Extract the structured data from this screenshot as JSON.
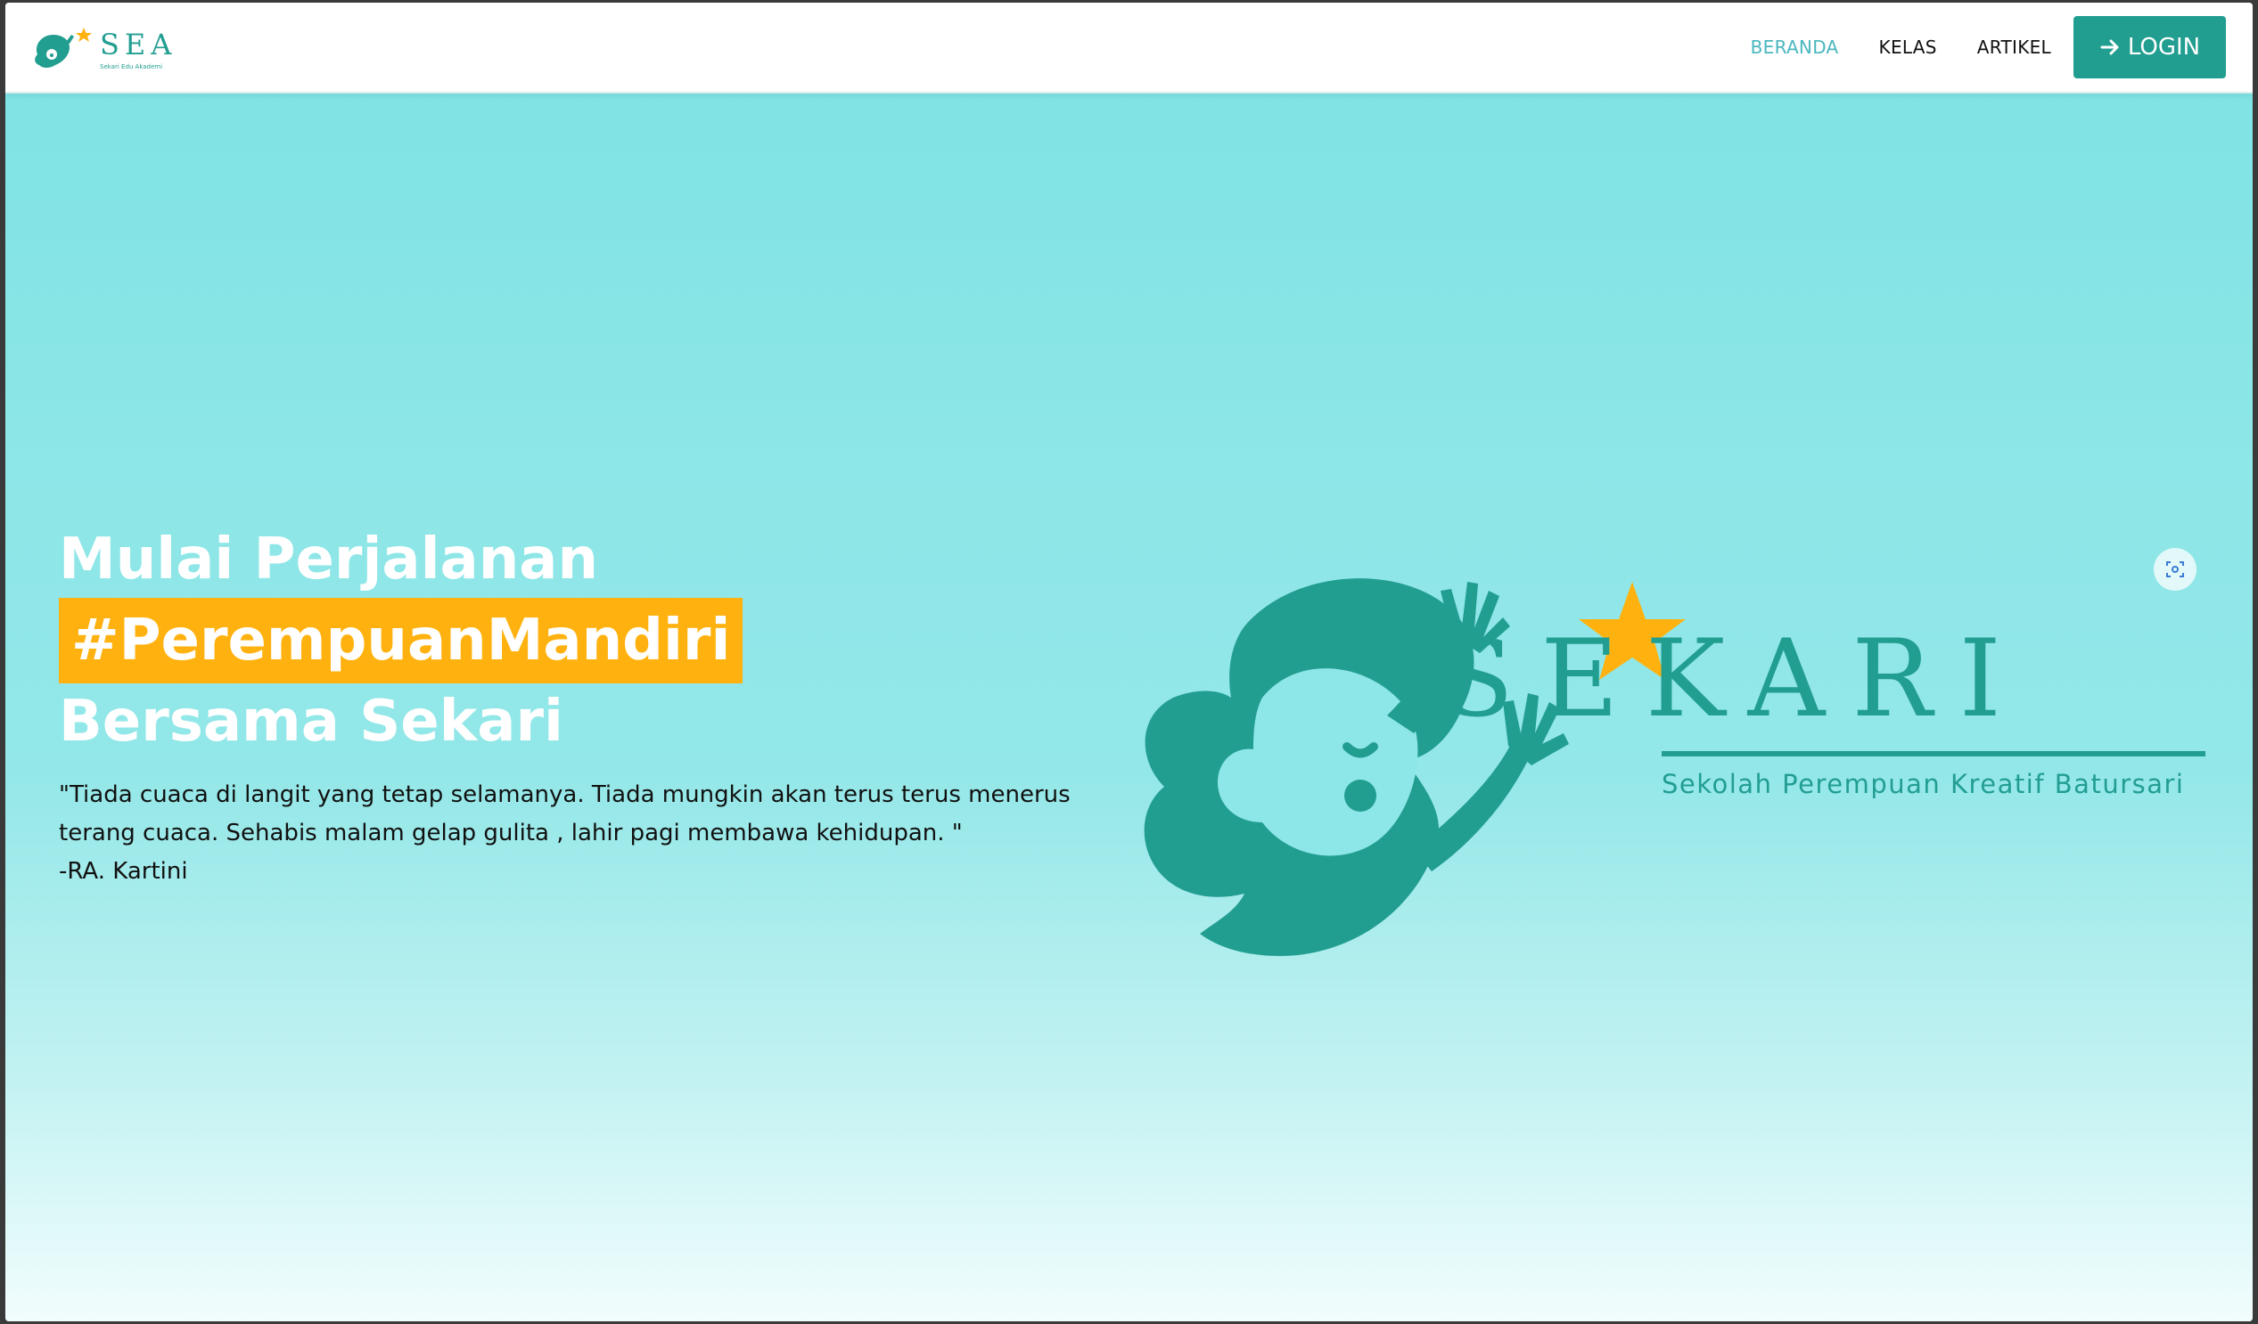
{
  "brand": {
    "name": "SEA",
    "tagline": "Sekari Edu Akademi"
  },
  "nav": {
    "items": [
      {
        "label": "BERANDA",
        "active": true
      },
      {
        "label": "KELAS",
        "active": false
      },
      {
        "label": "ARTIKEL",
        "active": false
      }
    ],
    "login_label": "LOGIN"
  },
  "hero": {
    "title_line1": "Mulai Perjalanan",
    "hashtag": "#PerempuanMandiri",
    "title_line3": "Bersama Sekari",
    "quote_line1": "\"Tiada cuaca di langit yang tetap selamanya. Tiada mungkin akan terus terus menerus",
    "quote_line2": "terang cuaca. Sehabis malam gelap gulita , lahir pagi membawa kehidupan. \"",
    "quote_author": "-RA. Kartini"
  },
  "logo": {
    "word": "SEKARI",
    "subtitle": "Sekolah Perempuan Kreatif Batursari"
  },
  "colors": {
    "accent": "#229e91",
    "active_link": "#49b7bf",
    "highlight": "#ffb20f",
    "hero_bg": "#8de6e7"
  },
  "icons": {
    "login": "arrow-right-icon",
    "scan": "scan-icon"
  }
}
